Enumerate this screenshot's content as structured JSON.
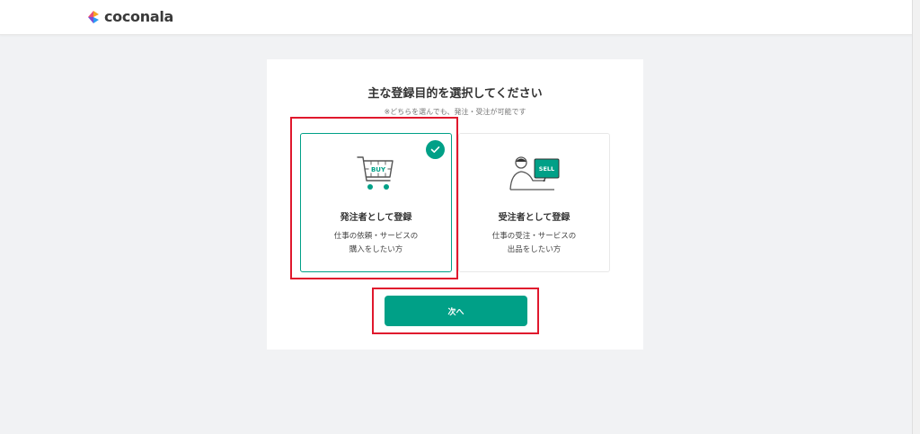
{
  "header": {
    "logo_text": "coconala",
    "logo_colors": [
      "#f5a623",
      "#e94e77",
      "#7b4fd6",
      "#2a9df4"
    ]
  },
  "page": {
    "title": "主な登録目的を選択してください",
    "subtitle": "※どちらを選んでも、発注・受注が可能です"
  },
  "options": [
    {
      "label": "発注者として登録",
      "desc_line1": "仕事の依頼・サービスの",
      "desc_line2": "購入をしたい方",
      "icon": "shopping-cart-icon",
      "icon_text": "BUY",
      "selected": true
    },
    {
      "label": "受注者として登録",
      "desc_line1": "仕事の受注・サービスの",
      "desc_line2": "出品をしたい方",
      "icon": "person-computer-icon",
      "icon_text": "SELL",
      "selected": false
    }
  ],
  "next_button": {
    "label": "次へ"
  },
  "colors": {
    "accent": "#00a087",
    "highlight": "#e0182d",
    "background": "#f1f2f4"
  }
}
